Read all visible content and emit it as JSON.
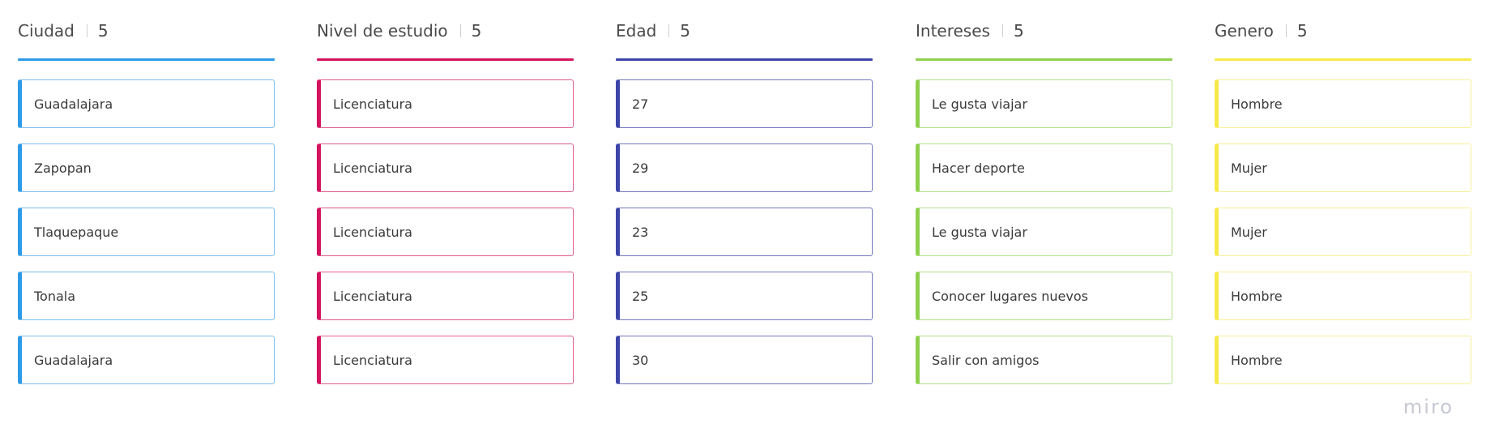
{
  "columns": [
    {
      "title": "Ciudad",
      "count": "5",
      "accent": "#2d9be8",
      "border": "#7cbef0",
      "cards": [
        "Guadalajara",
        "Zapopan",
        "Tlaquepaque",
        "Tonala",
        "Guadalajara"
      ]
    },
    {
      "title": "Nivel de estudio",
      "count": "5",
      "accent": "#d3135e",
      "border": "#e05c8f",
      "cards": [
        "Licenciatura",
        "Licenciatura",
        "Licenciatura",
        "Licenciatura",
        "Licenciatura"
      ]
    },
    {
      "title": "Edad",
      "count": "5",
      "accent": "#3e45a8",
      "border": "#7378bd",
      "cards": [
        "27",
        "29",
        "23",
        "25",
        "30"
      ]
    },
    {
      "title": "Intereses",
      "count": "5",
      "accent": "#8ed04e",
      "border": "#b3e08a",
      "cards": [
        "Le gusta viajar",
        "Hacer deporte",
        "Le gusta viajar",
        "Conocer lugares nuevos",
        "Salir con amigos"
      ]
    },
    {
      "title": "Genero",
      "count": "5",
      "accent": "#f7e94a",
      "border": "#f8ef98",
      "cards": [
        "Hombre",
        "Mujer",
        "Mujer",
        "Hombre",
        "Hombre"
      ]
    }
  ],
  "logo": "miro"
}
